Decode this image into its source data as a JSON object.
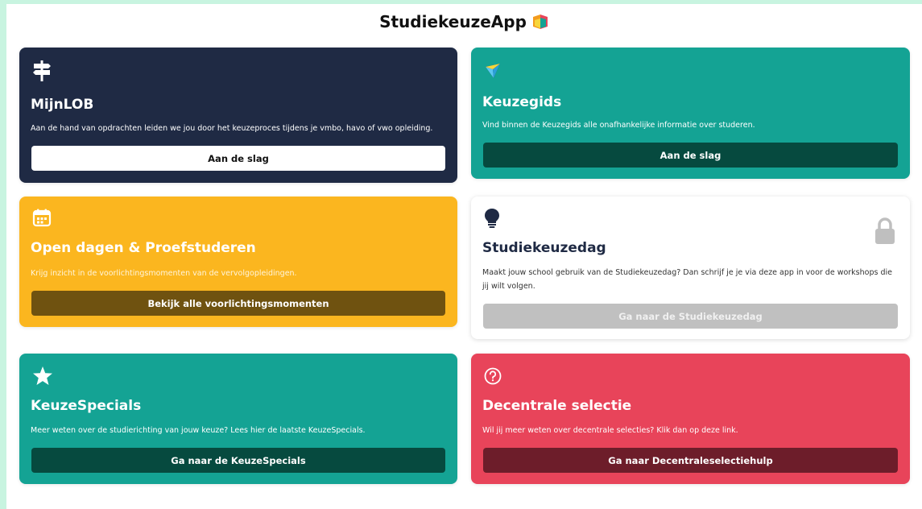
{
  "app": {
    "title": "StudiekeuzeApp"
  },
  "colors": {
    "dark": "#1f2a44",
    "teal": "#14a394",
    "amber": "#fbb61f",
    "red": "#e8445a",
    "teal_button": "#064a3f",
    "amber_button": "#6f5210",
    "red_button": "#6d1d2a",
    "disabled_button": "#c0c0c0"
  },
  "cards": [
    {
      "icon": "signpost-icon",
      "title": "MijnLOB",
      "text": "Aan de hand van opdrachten leiden we jou door het keuzeproces tijdens je vmbo, havo of vwo opleiding.",
      "button": "Aan de slag"
    },
    {
      "icon": "compass-gem-icon",
      "title": "Keuzegids",
      "text": "Vind binnen de Keuzegids alle onafhankelijke informatie over studeren.",
      "button": "Aan de slag"
    },
    {
      "icon": "calendar-icon",
      "title": "Open dagen & Proefstuderen",
      "text": "Krijg inzicht in de voorlichtingsmomenten van de vervolgopleidingen.",
      "button": "Bekijk alle voorlichtingsmomenten"
    },
    {
      "icon": "lightbulb-icon",
      "title": "Studiekeuzedag",
      "text": "Maakt jouw school gebruik van de Studiekeuzedag? Dan schrijf je je via deze app in voor de workshops die jij wilt volgen.",
      "button": "Ga naar de Studiekeuzedag",
      "locked": true
    },
    {
      "icon": "star-icon",
      "title": "KeuzeSpecials",
      "text": "Meer weten over de studierichting van jouw keuze? Lees hier de laatste KeuzeSpecials.",
      "button": "Ga naar de KeuzeSpecials"
    },
    {
      "icon": "question-circle-icon",
      "title": "Decentrale selectie",
      "text": "Wil jij meer weten over decentrale selecties? Klik dan op deze link.",
      "button": "Ga naar Decentraleselectiehulp"
    }
  ]
}
